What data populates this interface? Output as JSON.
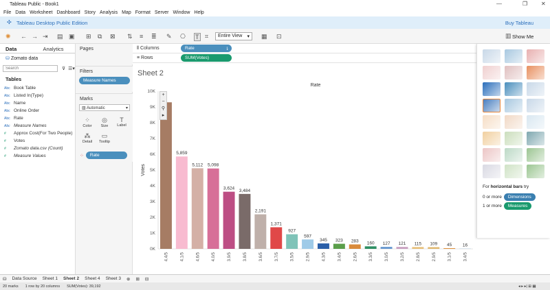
{
  "window": {
    "title": "Tableau Public - Book1",
    "controls": [
      "—",
      "❐",
      "✕"
    ]
  },
  "menu": [
    "File",
    "Data",
    "Worksheet",
    "Dashboard",
    "Story",
    "Analysis",
    "Map",
    "Format",
    "Server",
    "Window",
    "Help"
  ],
  "banner": {
    "edition": "Tableau Desktop Public Edition",
    "buy": "Buy Tableau"
  },
  "toolbar": {
    "view_fit": "Entire View",
    "show_me": "Show Me"
  },
  "data_pane": {
    "tab_data": "Data",
    "tab_analytics": "Analytics",
    "source": "Zomato data",
    "search_placeholder": "Search",
    "tables_header": "Tables",
    "fields": [
      {
        "type": "Abc",
        "name": "Book Table",
        "kind": "dim",
        "italic": false
      },
      {
        "type": "Abc",
        "name": "Listed In(Type)",
        "kind": "dim",
        "italic": false
      },
      {
        "type": "Abc",
        "name": "Name",
        "kind": "dim",
        "italic": false
      },
      {
        "type": "Abc",
        "name": "Online Order",
        "kind": "dim",
        "italic": false
      },
      {
        "type": "Abc",
        "name": "Rate",
        "kind": "dim",
        "italic": false
      },
      {
        "type": "Abc",
        "name": "Measure Names",
        "kind": "dim",
        "italic": true
      },
      {
        "type": "#",
        "name": "Approx Cost(For Two People)",
        "kind": "meas",
        "italic": false
      },
      {
        "type": "#",
        "name": "Votes",
        "kind": "meas",
        "italic": false
      },
      {
        "type": "#",
        "name": "Zomato data.csv (Count)",
        "kind": "meas",
        "italic": true
      },
      {
        "type": "#",
        "name": "Measure Values",
        "kind": "meas",
        "italic": true
      }
    ]
  },
  "cards": {
    "pages": "Pages",
    "filters": "Filters",
    "filter_pill": "Measure Names",
    "marks": "Marks",
    "mark_type": "Automatic",
    "mark_buttons": [
      "Color",
      "Size",
      "Label",
      "Detail",
      "Tooltip"
    ],
    "color_pill": "Rate"
  },
  "shelves": {
    "columns_label": "Columns",
    "columns_pill": "Rate",
    "rows_label": "Rows",
    "rows_pill": "SUM(Votes)"
  },
  "sheet": {
    "title": "Sheet 2"
  },
  "showme": {
    "hint_prefix": "For ",
    "hint_bold": "horizontal bars",
    "hint_suffix": " try",
    "req1_prefix": "0 or more",
    "req1_pill": "Dimensions",
    "req2_prefix": "1 or more",
    "req2_pill": "Measures"
  },
  "sheet_tabs": [
    "Data Source",
    "Sheet 1",
    "Sheet 2",
    "Sheet 4",
    "Sheet 3"
  ],
  "active_sheet": "Sheet 2",
  "status": {
    "marks": "20 marks",
    "rows": "1 row by 20 columns",
    "sum": "SUM(Votes): 39,192"
  },
  "chart_data": {
    "type": "bar",
    "title": "Rate",
    "ylabel": "Votes",
    "ylim": [
      0,
      10000
    ],
    "yticks": [
      "0K",
      "1K",
      "2K",
      "3K",
      "4K",
      "5K",
      "6K",
      "7K",
      "8K",
      "9K",
      "10K"
    ],
    "categories": [
      "4.4/5",
      "4.1/5",
      "4.6/5",
      "4.0/5",
      "3.9/5",
      "3.8/5",
      "3.6/5",
      "3.7/5",
      "3.5/5",
      "2.9/5",
      "4.3/5",
      "3.4/5",
      "2.6/5",
      "3.3/5",
      "3.0/5",
      "3.2/5",
      "2.8/5",
      "2.9/5",
      "3.1/5",
      "3.4/5"
    ],
    "values": [
      9295,
      5859,
      5112,
      5098,
      3624,
      3484,
      2191,
      1371,
      927,
      597,
      345,
      323,
      283,
      160,
      127,
      121,
      115,
      109,
      45,
      16
    ],
    "labels": [
      "",
      "5,859",
      "5,112",
      "5,098",
      "3,624",
      "3,484",
      "2,191",
      "1,371",
      "927",
      "597",
      "345",
      "323",
      "283",
      "160",
      "127",
      "121",
      "115",
      "109",
      "45",
      "16"
    ],
    "colors": [
      "#a67c64",
      "#f8bbd0",
      "#d4b0a6",
      "#d76f98",
      "#bd4e84",
      "#7a6b69",
      "#bfb0aa",
      "#e04848",
      "#7fc3b8",
      "#9fcbe8",
      "#2a5fa8",
      "#5a9e4a",
      "#d98a3a",
      "#2e8f63",
      "#6a9ad0",
      "#c8a0c0",
      "#e8c07a",
      "#e0b870",
      "#e0903a",
      "#a8c8e0"
    ]
  }
}
